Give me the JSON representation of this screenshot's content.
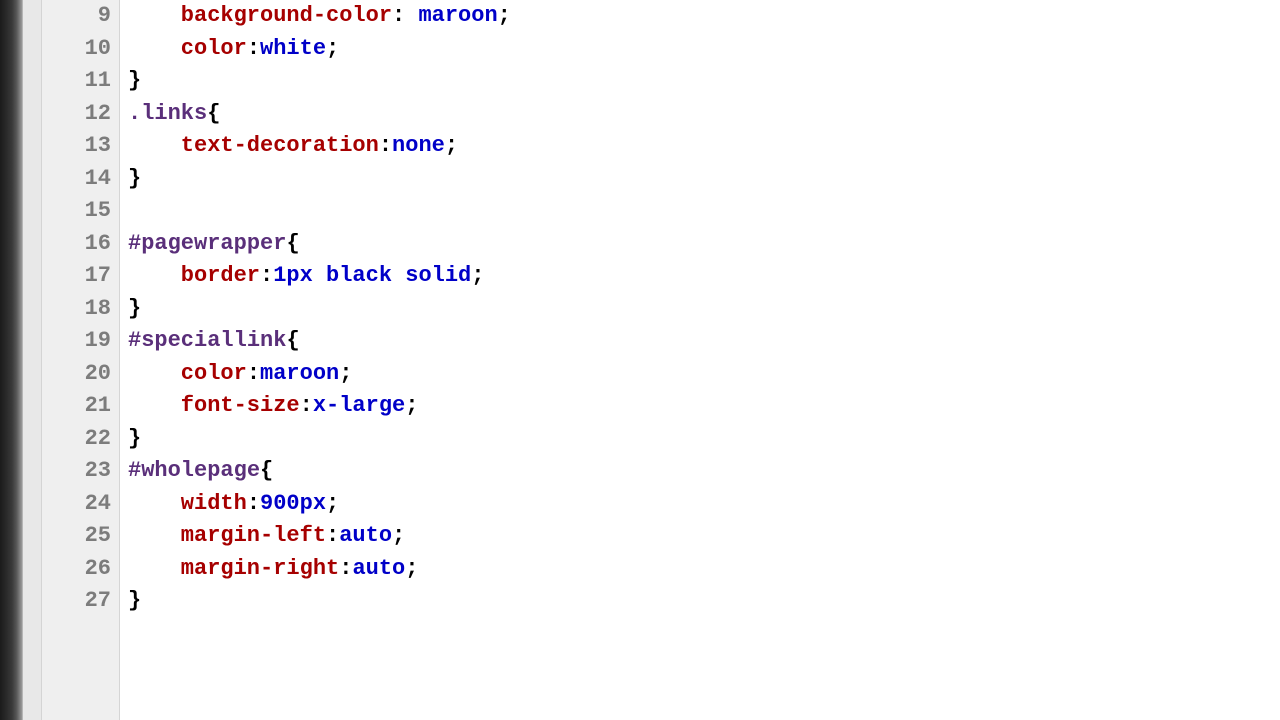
{
  "editor": {
    "startLine": 9,
    "lines": [
      {
        "num": "9",
        "tokens": [
          {
            "cls": "indent",
            "t": ""
          },
          {
            "cls": "kw-prop",
            "t": "background-color"
          },
          {
            "cls": "kw-punc",
            "t": ": "
          },
          {
            "cls": "kw-val",
            "t": "maroon"
          },
          {
            "cls": "kw-punc",
            "t": ";"
          }
        ]
      },
      {
        "num": "10",
        "tokens": [
          {
            "cls": "indent",
            "t": ""
          },
          {
            "cls": "kw-prop",
            "t": "color"
          },
          {
            "cls": "kw-punc",
            "t": ":"
          },
          {
            "cls": "kw-val",
            "t": "white"
          },
          {
            "cls": "kw-punc",
            "t": ";"
          }
        ]
      },
      {
        "num": "11",
        "tokens": [
          {
            "cls": "kw-punc",
            "t": "}"
          }
        ]
      },
      {
        "num": "12",
        "tokens": [
          {
            "cls": "kw-sel",
            "t": ".links"
          },
          {
            "cls": "kw-punc",
            "t": "{"
          }
        ]
      },
      {
        "num": "13",
        "tokens": [
          {
            "cls": "indent",
            "t": ""
          },
          {
            "cls": "kw-prop",
            "t": "text-decoration"
          },
          {
            "cls": "kw-punc",
            "t": ":"
          },
          {
            "cls": "kw-val",
            "t": "none"
          },
          {
            "cls": "kw-punc",
            "t": ";"
          }
        ]
      },
      {
        "num": "14",
        "tokens": [
          {
            "cls": "kw-punc",
            "t": "}"
          }
        ]
      },
      {
        "num": "15",
        "tokens": []
      },
      {
        "num": "16",
        "tokens": [
          {
            "cls": "kw-sel",
            "t": "#pagewrapper"
          },
          {
            "cls": "kw-punc",
            "t": "{"
          }
        ]
      },
      {
        "num": "17",
        "tokens": [
          {
            "cls": "indent",
            "t": ""
          },
          {
            "cls": "kw-prop",
            "t": "border"
          },
          {
            "cls": "kw-punc",
            "t": ":"
          },
          {
            "cls": "kw-num",
            "t": "1px"
          },
          {
            "cls": "kw-punc",
            "t": " "
          },
          {
            "cls": "kw-val",
            "t": "black"
          },
          {
            "cls": "kw-punc",
            "t": " "
          },
          {
            "cls": "kw-val",
            "t": "solid"
          },
          {
            "cls": "kw-punc",
            "t": ";"
          }
        ]
      },
      {
        "num": "18",
        "tokens": [
          {
            "cls": "kw-punc",
            "t": "}"
          }
        ]
      },
      {
        "num": "19",
        "tokens": [
          {
            "cls": "kw-sel",
            "t": "#speciallink"
          },
          {
            "cls": "kw-punc",
            "t": "{"
          }
        ]
      },
      {
        "num": "20",
        "tokens": [
          {
            "cls": "indent",
            "t": ""
          },
          {
            "cls": "kw-prop",
            "t": "color"
          },
          {
            "cls": "kw-punc",
            "t": ":"
          },
          {
            "cls": "kw-val",
            "t": "maroon"
          },
          {
            "cls": "kw-punc",
            "t": ";"
          }
        ]
      },
      {
        "num": "21",
        "tokens": [
          {
            "cls": "indent",
            "t": ""
          },
          {
            "cls": "kw-prop",
            "t": "font-size"
          },
          {
            "cls": "kw-punc",
            "t": ":"
          },
          {
            "cls": "kw-val",
            "t": "x-large"
          },
          {
            "cls": "kw-punc",
            "t": ";"
          }
        ]
      },
      {
        "num": "22",
        "tokens": [
          {
            "cls": "kw-punc",
            "t": "}"
          }
        ]
      },
      {
        "num": "23",
        "tokens": [
          {
            "cls": "kw-sel",
            "t": "#wholepage"
          },
          {
            "cls": "kw-punc",
            "t": "{"
          }
        ]
      },
      {
        "num": "24",
        "tokens": [
          {
            "cls": "indent",
            "t": ""
          },
          {
            "cls": "kw-prop",
            "t": "width"
          },
          {
            "cls": "kw-punc",
            "t": ":"
          },
          {
            "cls": "kw-num",
            "t": "900px"
          },
          {
            "cls": "kw-punc",
            "t": ";"
          }
        ]
      },
      {
        "num": "25",
        "tokens": [
          {
            "cls": "indent",
            "t": ""
          },
          {
            "cls": "kw-prop",
            "t": "margin-left"
          },
          {
            "cls": "kw-punc",
            "t": ":"
          },
          {
            "cls": "kw-val",
            "t": "auto"
          },
          {
            "cls": "kw-punc",
            "t": ";"
          }
        ]
      },
      {
        "num": "26",
        "tokens": [
          {
            "cls": "indent",
            "t": ""
          },
          {
            "cls": "kw-prop",
            "t": "margin-right"
          },
          {
            "cls": "kw-punc",
            "t": ":"
          },
          {
            "cls": "kw-val",
            "t": "auto"
          },
          {
            "cls": "kw-punc",
            "t": ";"
          }
        ]
      },
      {
        "num": "27",
        "tokens": [
          {
            "cls": "kw-punc",
            "t": "}"
          }
        ]
      }
    ]
  }
}
